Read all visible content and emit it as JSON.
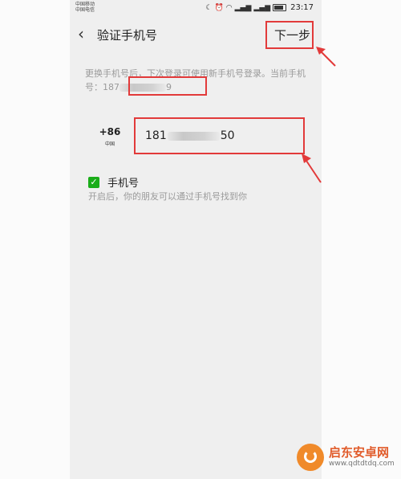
{
  "status_bar": {
    "carrier_1": "中国移动",
    "carrier_2": "中国电信",
    "icons": [
      "moon-icon",
      "alarm-icon",
      "wifi-icon",
      "signal-icon",
      "signal-icon",
      "battery-icon"
    ],
    "time": "23:17"
  },
  "navbar": {
    "back_icon": "chevron-left-icon",
    "title": "验证手机号",
    "next_label": "下一步"
  },
  "description": {
    "text": "更换手机号后，下次登录可使用新手机号登录。当前手机号：",
    "current_prefix": "187",
    "current_suffix": "9"
  },
  "phone_input": {
    "country_code": "+86",
    "region": "中国",
    "value_prefix": "181",
    "value_suffix": "50"
  },
  "option": {
    "checked": true,
    "label": "手机号",
    "hint": "开启后，你的朋友可以通过手机号找到你"
  },
  "watermark": {
    "name": "启东安卓网",
    "url": "www.qdtdtdq.com"
  },
  "colors": {
    "annotation": "#e23a3a",
    "checkbox": "#1aad19",
    "background": "#efefef"
  }
}
